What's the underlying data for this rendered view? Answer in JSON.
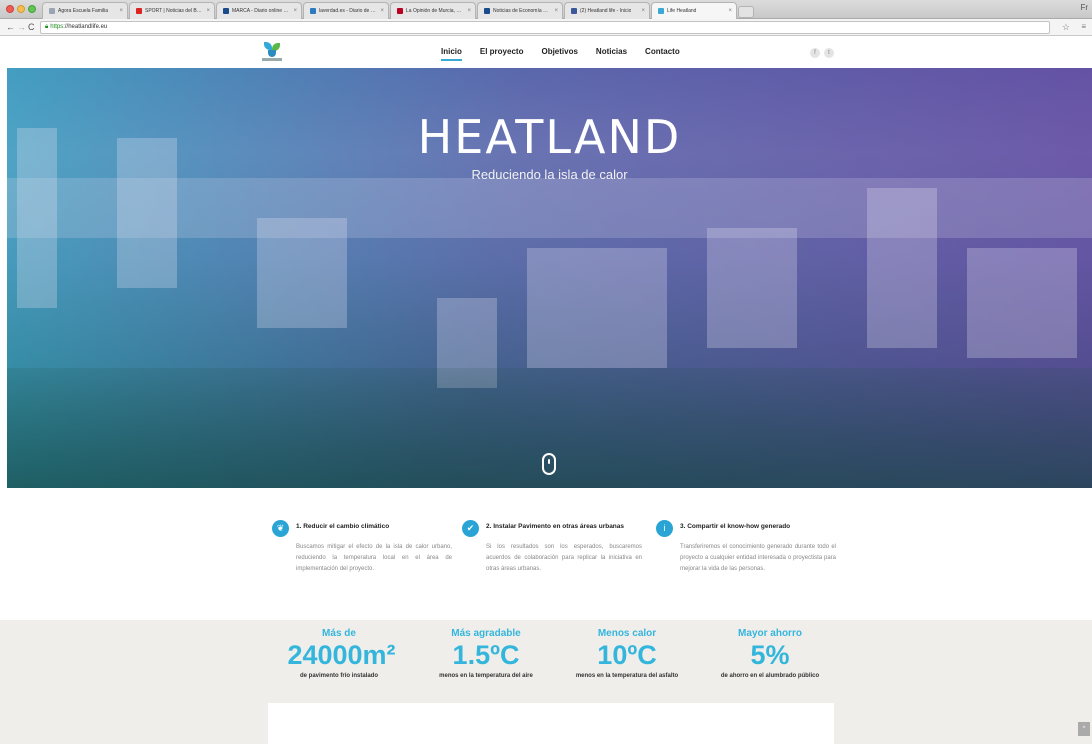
{
  "browser": {
    "tabs": [
      {
        "label": "Agora Escuela Familia",
        "favicon_color": "#9aa7b3",
        "active": false
      },
      {
        "label": "SPORT | Noticias del Barça",
        "favicon_color": "#d22",
        "active": false
      },
      {
        "label": "MARCA - Diario online lí...",
        "favicon_color": "#1a4c8b",
        "active": false
      },
      {
        "label": "laverdad.es - Diario de M...",
        "favicon_color": "#2a7bc1",
        "active": false
      },
      {
        "label": "La Opinión de Murcia, dia...",
        "favicon_color": "#b02",
        "active": false
      },
      {
        "label": "Noticias de Economía Ru...",
        "favicon_color": "#1a4c8b",
        "active": false
      },
      {
        "label": "(2) Heatland life - Inicio",
        "favicon_color": "#3b5998",
        "active": false
      },
      {
        "label": "Life Heatland",
        "favicon_color": "#39a9d6",
        "active": true
      }
    ],
    "top_right_letter": "Fr",
    "url_protocol": "https",
    "url_rest": "://heatlandlife.eu"
  },
  "nav": {
    "items": [
      "Inicio",
      "El proyecto",
      "Objetivos",
      "Noticias",
      "Contacto"
    ],
    "active_index": 0,
    "social": {
      "facebook": "f",
      "twitter": "t"
    }
  },
  "hero": {
    "title": "HEATLAND",
    "subtitle": "Reduciendo la isla de calor"
  },
  "objectives": [
    {
      "title": "1. Reducir el cambio climático",
      "text": "Buscamos mitigar el efecto de la isla de calor urbano, reduciendo la temperatura local en el área de implementación del proyecto.",
      "icon": "leaf-icon"
    },
    {
      "title": "2. Instalar Pavimento en otras áreas urbanas",
      "text": "Si los resultados son los esperados, buscaremos acuerdos de colaboración para replicar la iniciativa en otras áreas urbanas.",
      "icon": "check-icon"
    },
    {
      "title": "3. Compartir el know-how generado",
      "text": "Transferiremos el conocimiento generado durante todo el proyecto a cualquier entidad interesada o proyectista para mejorar la vida de las personas.",
      "icon": "info-icon"
    }
  ],
  "stats": [
    {
      "label": "Más de",
      "value": "24000m²",
      "desc": "de pavimento frío instalado"
    },
    {
      "label": "Más agradable",
      "value": "1.5ºC",
      "desc": "menos en la temperatura del aire"
    },
    {
      "label": "Menos calor",
      "value": "10ºC",
      "desc": "menos en la temperatura del asfalto"
    },
    {
      "label": "Mayor ahorro",
      "value": "5%",
      "desc": "de ahorro en el alumbrado público"
    }
  ],
  "colors": {
    "accent": "#34b6dc",
    "icon_bg": "#2aa4d5",
    "stats_bg": "#efeeeb"
  }
}
